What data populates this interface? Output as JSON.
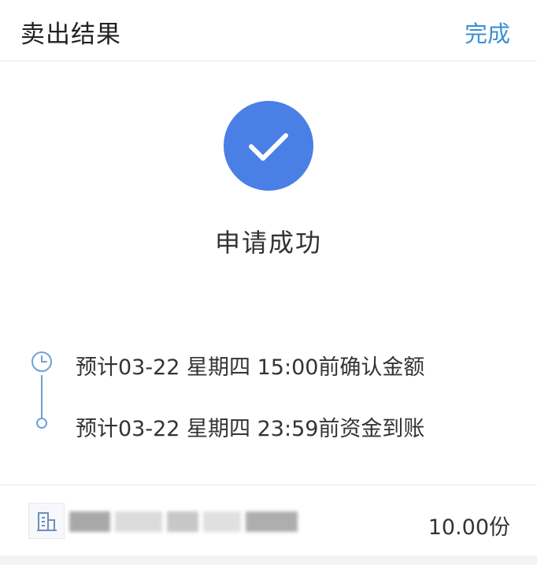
{
  "header": {
    "title": "卖出结果",
    "done_label": "完成"
  },
  "result": {
    "icon": "check-circle-icon",
    "status_text": "申请成功",
    "accent_color": "#4a7fe6"
  },
  "timeline": {
    "steps": [
      {
        "text": "预计03-22 星期四 15:00前确认金额",
        "icon": "clock-icon"
      },
      {
        "text": "预计03-22 星期四 23:59前资金到账",
        "icon": "dot-icon"
      }
    ]
  },
  "fund": {
    "icon": "building-icon",
    "shares": "10.00份"
  },
  "colors": {
    "link": "#3d8fd6",
    "timeline": "#6fa0d8"
  }
}
